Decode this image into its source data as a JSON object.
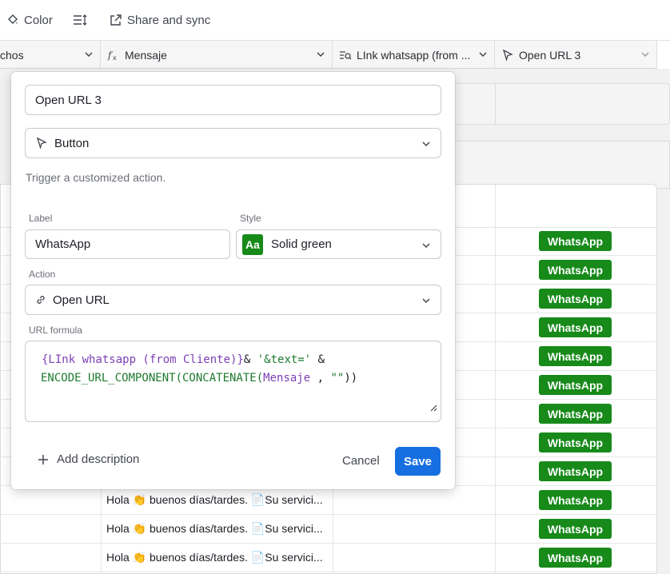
{
  "toolbar": {
    "color_label": "Color",
    "share_label": "Share and sync"
  },
  "columns": {
    "col1": "chos",
    "col2": "Mensaje",
    "col3": "LInk whatsapp (from ...",
    "col4": "Open URL 3"
  },
  "rows": [
    {
      "message": "",
      "button": "WhatsApp"
    },
    {
      "message": "",
      "button": "WhatsApp"
    },
    {
      "message": "",
      "button": "WhatsApp"
    },
    {
      "message": "",
      "button": "WhatsApp"
    },
    {
      "message": "",
      "button": "WhatsApp"
    },
    {
      "message": "",
      "button": "WhatsApp"
    },
    {
      "message": "",
      "button": "WhatsApp"
    },
    {
      "message": "",
      "button": "WhatsApp"
    },
    {
      "message": "",
      "button": "WhatsApp"
    },
    {
      "message": "Hola 👏 buenos días/tardes. 📄Su servici...",
      "button": "WhatsApp"
    },
    {
      "message": "Hola 👏 buenos días/tardes. 📄Su servici...",
      "button": "WhatsApp"
    },
    {
      "message": "Hola 👏 buenos días/tardes. 📄Su servici...",
      "button": "WhatsApp"
    }
  ],
  "modal": {
    "field_name": "Open URL 3",
    "field_type": "Button",
    "type_description": "Trigger a customized action.",
    "label_caption": "Label",
    "label_value": "WhatsApp",
    "style_caption": "Style",
    "style_badge": "Aa",
    "style_value": "Solid green",
    "action_caption": "Action",
    "action_value": "Open URL",
    "formula_caption": "URL formula",
    "formula": {
      "part1": "{LInk whatsapp (from Cliente)}",
      "part2": "& ",
      "part3": "'&text='",
      "part4": " &",
      "part5": "ENCODE_URL_COMPONENT(CONCATENATE(",
      "part6": "Mensaje",
      "part7": " , ",
      "part8": "\"\"",
      "part9": "))"
    },
    "add_description": "Add description",
    "cancel": "Cancel",
    "save": "Save"
  },
  "colors": {
    "button_green": "#178a1a",
    "save_blue": "#166ee1"
  }
}
